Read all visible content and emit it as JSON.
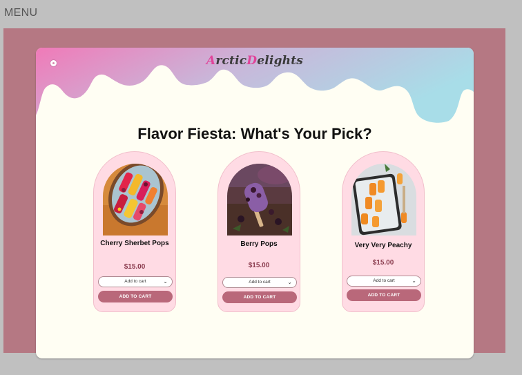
{
  "menu": {
    "label": "MENU"
  },
  "brand": {
    "first_letter": "A",
    "part1": "rctic",
    "second_letter": "D",
    "part2": "elights"
  },
  "page": {
    "title": "Flavor Fiesta: What's Your Pick?"
  },
  "colors": {
    "frame": "#b57883",
    "window": "#fffef3",
    "card": "#ffdbe4",
    "button": "#b9687a",
    "price": "#8a3b4d",
    "gradient_left": "#f07ab8",
    "gradient_right": "#a8dde8"
  },
  "products": [
    {
      "name": "Cherry Sherbet Pops",
      "price": "$15.00",
      "select_value": "Add to cart",
      "button_label": "ADD TO CART",
      "image": "cherry-sherbet-popsicles"
    },
    {
      "name": "Berry Pops",
      "price": "$15.00",
      "select_value": "Add to cart",
      "button_label": "ADD TO CART",
      "image": "berry-popsicle"
    },
    {
      "name": "Very Very Peachy",
      "price": "$15.00",
      "select_value": "Add to cart",
      "button_label": "ADD TO CART",
      "image": "peach-popsicles"
    }
  ]
}
